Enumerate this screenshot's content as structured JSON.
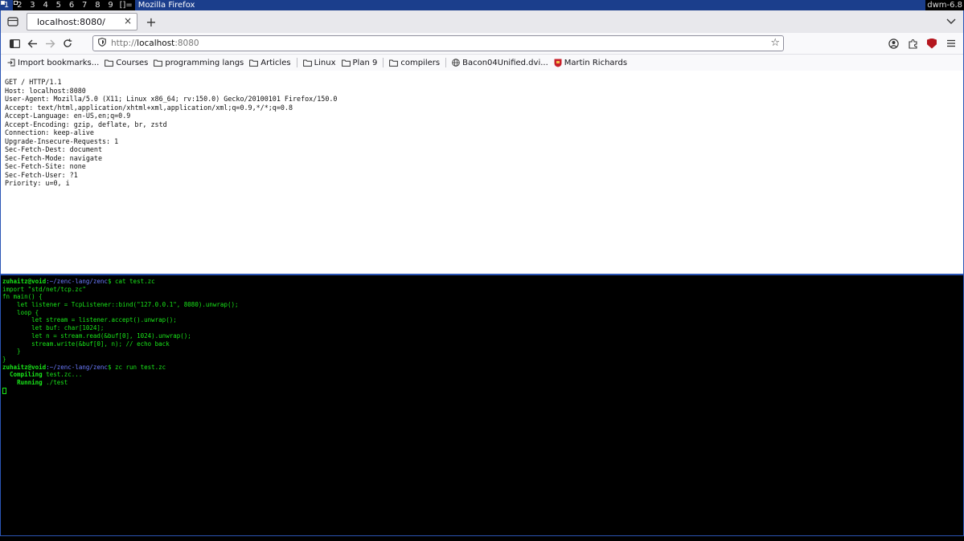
{
  "dwm": {
    "tags": [
      "1",
      "2",
      "3",
      "4",
      "5",
      "6",
      "7",
      "8",
      "9"
    ],
    "layout_symbol": "[]=",
    "window_title": "Mozilla Firefox",
    "status": "dwm-6.8"
  },
  "firefox": {
    "tab": {
      "title": "localhost:8080/",
      "close": "×"
    },
    "new_tab": "+",
    "url": {
      "scheme": "http://",
      "host": "localhost",
      "port": ":8080"
    },
    "bookmarks": [
      {
        "label": "Import bookmarks...",
        "icon": "import-icon"
      },
      {
        "label": "Courses",
        "icon": "folder-icon"
      },
      {
        "label": "programming langs",
        "icon": "folder-icon"
      },
      {
        "label": "Articles",
        "icon": "folder-icon"
      },
      {
        "label": "Linux",
        "icon": "folder-icon"
      },
      {
        "label": "Plan 9",
        "icon": "folder-icon"
      },
      {
        "label": "compilers",
        "icon": "folder-icon"
      },
      {
        "label": "Bacon04Unified.dvi...",
        "icon": "globe-icon"
      },
      {
        "label": "Martin Richards",
        "icon": "shield-crest-icon"
      }
    ],
    "page_text": "GET / HTTP/1.1\nHost: localhost:8080\nUser-Agent: Mozilla/5.0 (X11; Linux x86_64; rv:150.0) Gecko/20100101 Firefox/150.0\nAccept: text/html,application/xhtml+xml,application/xml;q=0.9,*/*;q=0.8\nAccept-Language: en-US,en;q=0.9\nAccept-Encoding: gzip, deflate, br, zstd\nConnection: keep-alive\nUpgrade-Insecure-Requests: 1\nSec-Fetch-Dest: document\nSec-Fetch-Mode: navigate\nSec-Fetch-Site: none\nSec-Fetch-User: ?1\nPriority: u=0, i"
  },
  "terminal": {
    "prompt_user": "zuhaitz@void",
    "prompt_path": ":~/zenc-lang/zenc",
    "prompt_symbol": "$",
    "cmd1": " cat test.zc",
    "code": [
      "import \"std/net/tcp.zc\"",
      "fn main() {",
      "    let listener = TcpListener::bind(\"127.0.0.1\", 8080).unwrap();",
      "    loop {",
      "        let stream = listener.accept().unwrap();",
      "        let buf: char[1024];",
      "        let n = stream.read(&buf[0], 1024).unwrap();",
      "        stream.write(&buf[0], n); // echo back",
      "    }",
      "}"
    ],
    "cmd2": " zc run test.zc",
    "compiling_label": "Compiling",
    "compiling_file": " test.zc...",
    "running_label": "Running",
    "running_file": " ./test"
  }
}
